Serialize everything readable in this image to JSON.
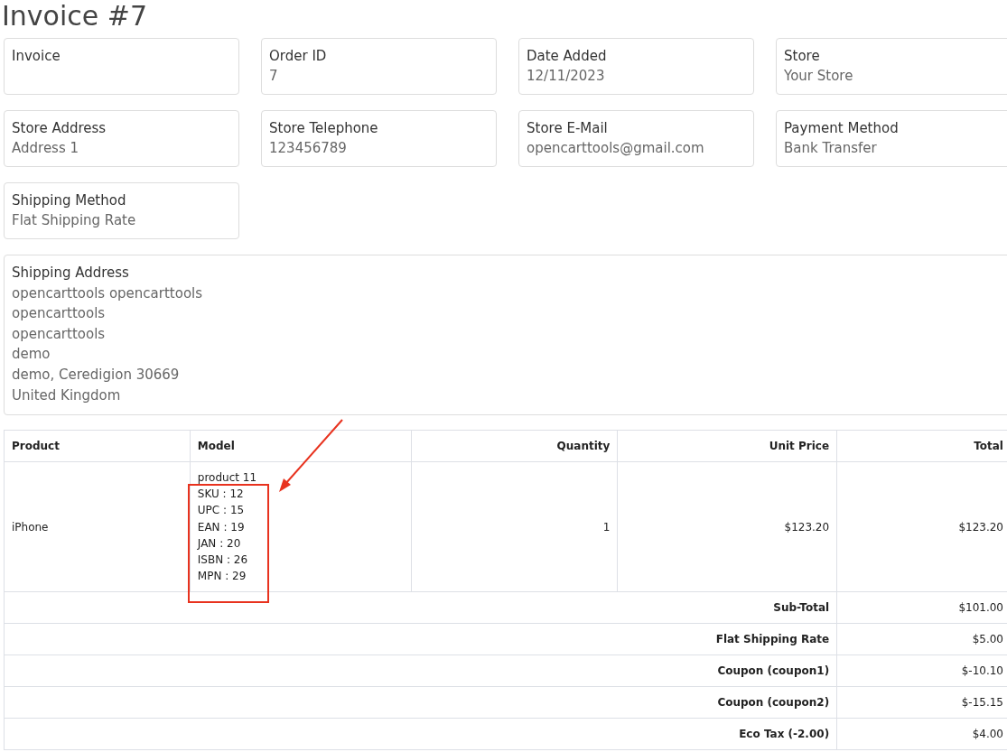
{
  "title": "Invoice #7",
  "info_cards": [
    {
      "label": "Invoice"
    },
    {
      "label": "Order ID",
      "value": "7"
    },
    {
      "label": "Date Added",
      "value": "12/11/2023"
    },
    {
      "label": "Store",
      "value": "Your Store"
    },
    {
      "label": "Store Address",
      "value": "Address 1"
    },
    {
      "label": "Store Telephone",
      "value": "123456789"
    },
    {
      "label": "Store E-Mail",
      "value": "opencarttools@gmail.com"
    },
    {
      "label": "Payment Method",
      "value": "Bank Transfer"
    },
    {
      "label": "Shipping Method",
      "value": "Flat Shipping Rate"
    }
  ],
  "shipping_address": {
    "label": "Shipping Address",
    "lines": [
      "opencarttools opencarttools",
      "opencarttools",
      "opencarttools",
      "demo",
      "demo, Ceredigion 30669",
      "United Kingdom"
    ]
  },
  "table": {
    "columns": [
      "Product",
      "Model",
      "Quantity",
      "Unit Price",
      "Total"
    ],
    "rows": [
      {
        "product": "iPhone",
        "model": "product 11",
        "attributes": [
          "SKU : 12",
          "UPC : 15",
          "EAN : 19",
          "JAN : 20",
          "ISBN : 26",
          "MPN : 29"
        ],
        "quantity": "1",
        "unit_price": "$123.20",
        "total": "$123.20"
      }
    ],
    "totals": [
      {
        "label": "Sub-Total",
        "value": "$101.00"
      },
      {
        "label": "Flat Shipping Rate",
        "value": "$5.00"
      },
      {
        "label": "Coupon (coupon1)",
        "value": "$-10.10"
      },
      {
        "label": "Coupon (coupon2)",
        "value": "$-15.15"
      },
      {
        "label": "Eco Tax (-2.00)",
        "value": "$4.00"
      }
    ]
  }
}
